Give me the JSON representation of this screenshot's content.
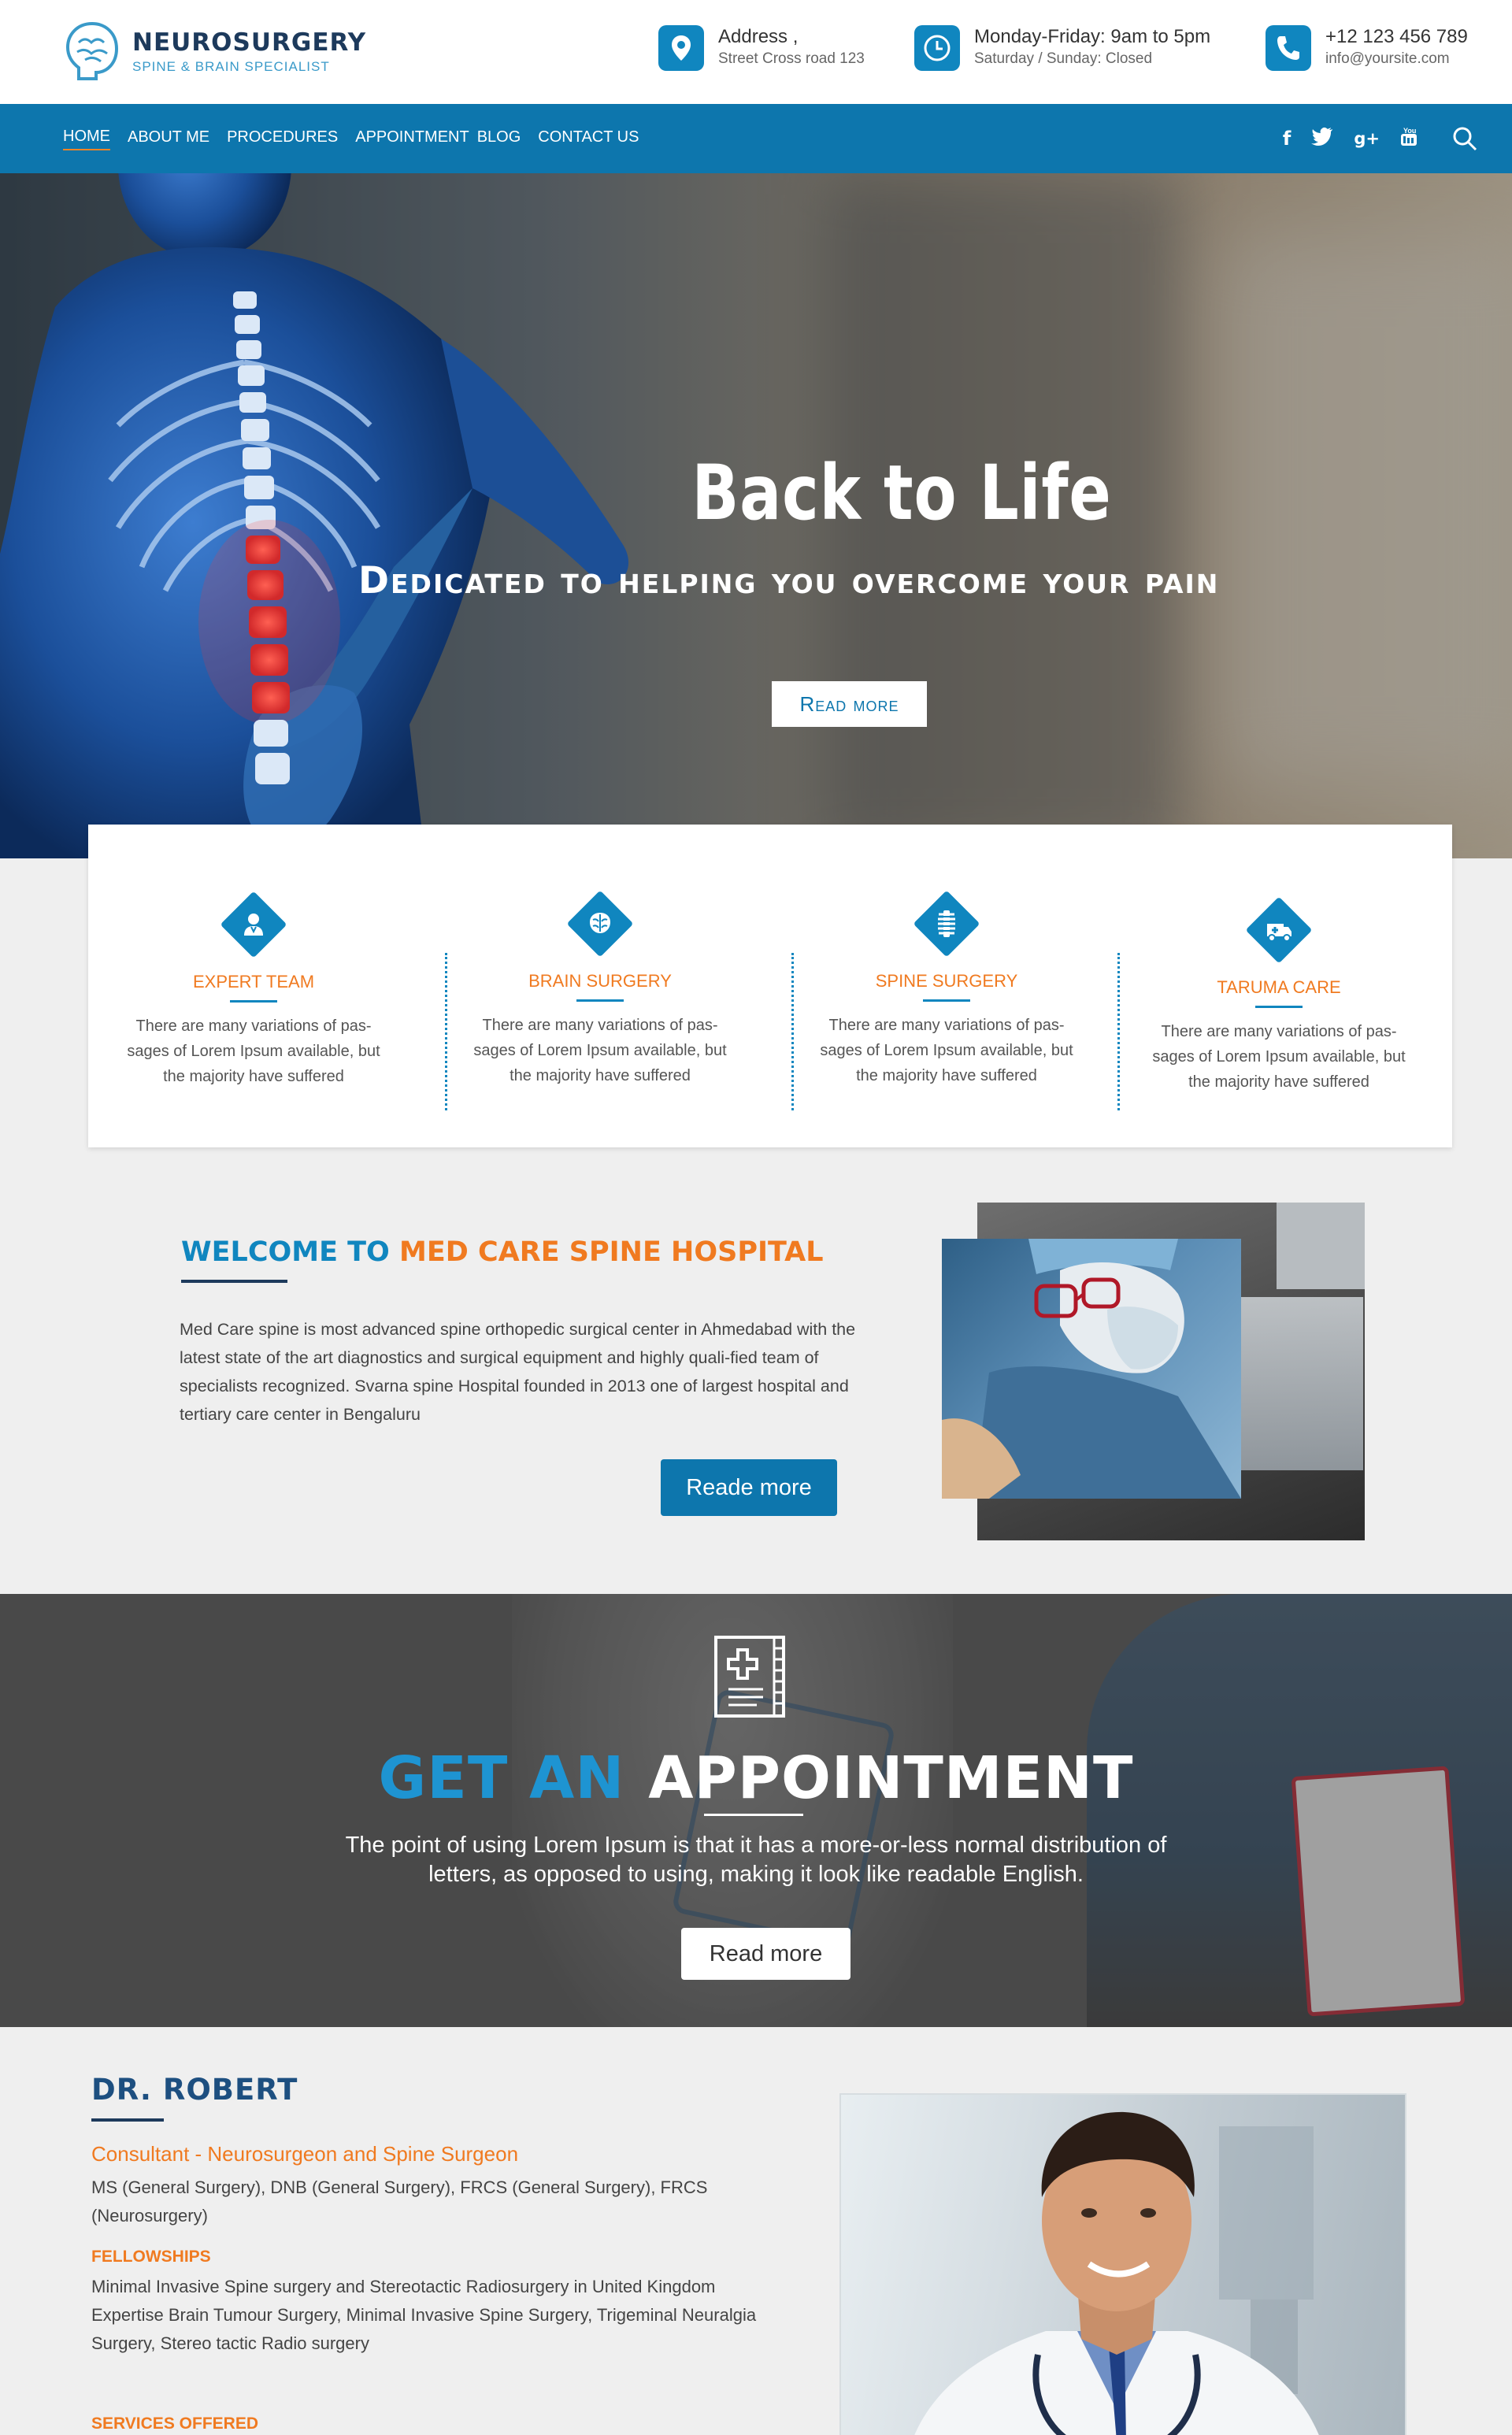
{
  "header": {
    "logo_title": "NEUROSURGERY",
    "logo_subtitle": "SPINE & BRAIN SPECIALIST",
    "contacts": [
      {
        "icon": "location-pin-icon",
        "line1": "Address ,",
        "line2": "Street Cross road 123"
      },
      {
        "icon": "clock-icon",
        "line1": "Monday-Friday: 9am to 5pm",
        "line2": "Saturday / Sunday: Closed"
      },
      {
        "icon": "phone-icon",
        "line1": "+12 123 456 789",
        "line2": "info@yoursite.com"
      }
    ]
  },
  "nav": {
    "links": [
      "HOME",
      "ABOUT ME",
      "PROCEDURES",
      "APPOINTMENT",
      "BLOG",
      "CONTACT US"
    ],
    "active": "HOME",
    "social": [
      "f",
      "t",
      "g+",
      "yt"
    ],
    "search_icon": "search-icon"
  },
  "hero": {
    "title": "Back to Life",
    "subtitle": "Dedicated to helping you overcome your pain",
    "button": "Read more"
  },
  "features": [
    {
      "icon": "doctor-icon",
      "title": "EXPERT TEAM",
      "desc": "There are many variations of pas-sages of Lorem Ipsum available, but the majority have suffered"
    },
    {
      "icon": "brain-icon",
      "title": "BRAIN SURGERY",
      "desc": "There are many variations of pas-sages of Lorem Ipsum available, but the majority have suffered"
    },
    {
      "icon": "spine-icon",
      "title": "SPINE SURGERY",
      "desc": "There are many variations of pas-sages of Lorem Ipsum available, but the majority have suffered"
    },
    {
      "icon": "ambulance-icon",
      "title": "TARUMA CARE",
      "desc": "There are many variations of pas-sages of Lorem Ipsum available, but the majority have suffered"
    }
  ],
  "welcome": {
    "title_prefix": "WELCOME TO",
    "title_highlight": "MED CARE SPINE HOSPITAL",
    "text": "Med Care spine is most advanced spine orthopedic surgical center in Ahmedabad with the latest state of the art diagnostics and surgical equipment and highly quali-fied team of specialists recognized. Svarna spine Hospital founded in 2013 one of largest hospital and tertiary care center in Bengaluru",
    "button": "Reade more"
  },
  "appointment": {
    "title_prefix": "GET AN",
    "title_main": "APPOINTMENT",
    "text": "The point of using Lorem Ipsum is that it has a more-or-less normal distribution of letters, as opposed to using, making it look like readable English.",
    "button": "Read  more"
  },
  "doctor": {
    "name": "DR. ROBERT",
    "role": "Consultant - Neurosurgeon and Spine Surgeon",
    "qualifications": "MS (General Surgery), DNB (General Surgery), FRCS (General Surgery), FRCS (Neurosurgery)",
    "fellowships_heading": "FELLOWSHIPS",
    "fellowships_text": "Minimal Invasive Spine surgery and Stereotactic Radiosurgery in United Kingdom Expertise Brain Tumour Surgery, Minimal Invasive Spine Surgery, Trigeminal Neuralgia Surgery, Stereo tactic Radio surgery",
    "services_heading": "SERVICES OFFERED"
  },
  "colors": {
    "primary_blue": "#0d76ad",
    "accent_orange": "#f07a20",
    "navy": "#1d3a5c"
  }
}
